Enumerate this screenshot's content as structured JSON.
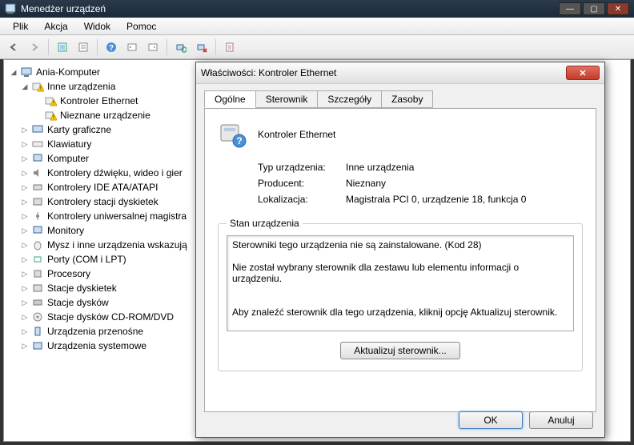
{
  "titlebar": {
    "title": "Menedżer urządzeń"
  },
  "menu": {
    "file": "Plik",
    "action": "Akcja",
    "view": "Widok",
    "help": "Pomoc"
  },
  "tree": {
    "root": "Ania-Komputer",
    "other_devices": "Inne urządzenia",
    "ethernet_controller": "Kontroler Ethernet",
    "unknown_device": "Nieznane urządzenie",
    "display_adapters": "Karty graficzne",
    "keyboards": "Klawiatury",
    "computer": "Komputer",
    "sound_video_game": "Kontrolery dźwięku, wideo i gier",
    "ide_atapi": "Kontrolery IDE ATA/ATAPI",
    "floppy_controllers": "Kontrolery stacji dyskietek",
    "usb_controllers": "Kontrolery uniwersalnej magistra",
    "monitors": "Monitory",
    "mice": "Mysz i inne urządzenia wskazują",
    "ports": "Porty (COM i LPT)",
    "processors": "Procesory",
    "floppy_drives": "Stacje dyskietek",
    "disk_drives": "Stacje dysków",
    "dvd_drives": "Stacje dysków CD-ROM/DVD",
    "portable": "Urządzenia przenośne",
    "system": "Urządzenia systemowe"
  },
  "dialog": {
    "title": "Właściwości: Kontroler Ethernet",
    "tabs": {
      "general": "Ogólne",
      "driver": "Sterownik",
      "details": "Szczegóły",
      "resources": "Zasoby"
    },
    "device_name": "Kontroler Ethernet",
    "type_label": "Typ urządzenia:",
    "type_value": "Inne urządzenia",
    "mfr_label": "Producent:",
    "mfr_value": "Nieznany",
    "loc_label": "Lokalizacja:",
    "loc_value": "Magistrala PCI 0, urządzenie 18, funkcja 0",
    "status_group": "Stan urządzenia",
    "status_text": "Sterowniki tego urządzenia nie są zainstalowane. (Kod 28)\n\nNie został wybrany sterownik dla zestawu lub elementu informacji o urządzeniu.\n\n\nAby znaleźć sterownik dla tego urządzenia, kliknij opcję Aktualizuj sterownik.",
    "update_btn": "Aktualizuj sterownik...",
    "ok": "OK",
    "cancel": "Anuluj"
  }
}
